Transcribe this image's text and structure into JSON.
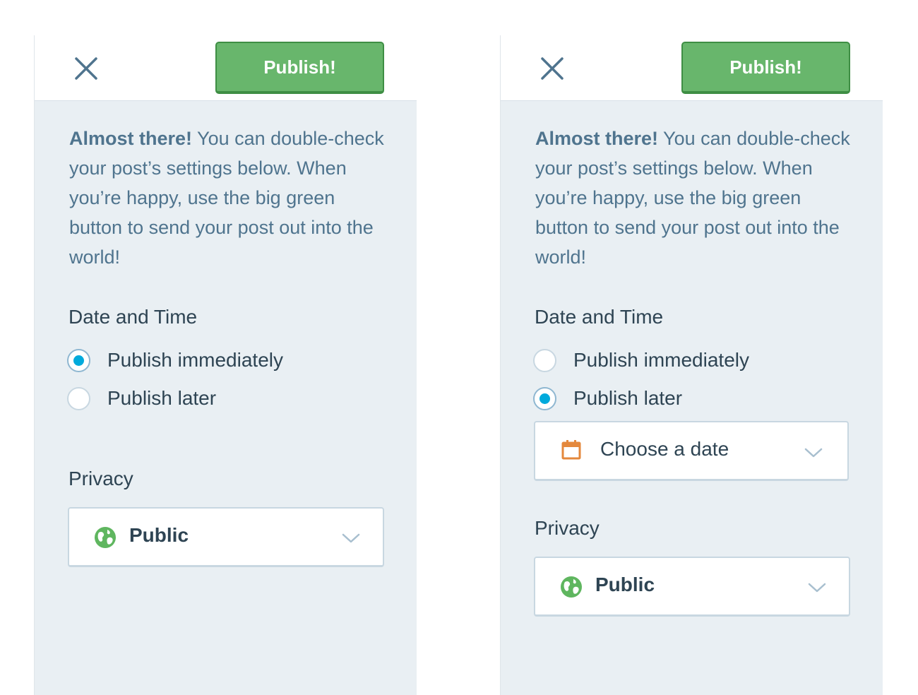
{
  "panels": [
    {
      "publish_label": "Publish!",
      "intro_bold": "Almost there!",
      "intro_rest": " You can double-check your post’s settings below. When you’re happy, use the big green button to send your post out into the world!",
      "date_time_label": "Date and Time",
      "options": [
        {
          "label": "Publish immediately",
          "selected": true
        },
        {
          "label": "Publish later",
          "selected": false
        }
      ],
      "privacy_label": "Privacy",
      "privacy_value": "Public",
      "icons": {
        "close": "close-icon",
        "globe": "globe-icon",
        "chevron": "chevron-down-icon"
      }
    },
    {
      "publish_label": "Publish!",
      "intro_bold": "Almost there!",
      "intro_rest": " You can double-check your post’s settings below. When you’re happy, use the big green button to send your post out into the world!",
      "date_time_label": "Date and Time",
      "options": [
        {
          "label": "Publish immediately",
          "selected": false
        },
        {
          "label": "Publish later",
          "selected": true
        }
      ],
      "date_picker_value": "Choose a date",
      "privacy_label": "Privacy",
      "privacy_value": "Public",
      "icons": {
        "close": "close-icon",
        "calendar": "calendar-icon",
        "globe": "globe-icon",
        "chevron": "chevron-down-icon"
      }
    }
  ],
  "colors": {
    "publish_green": "#68b66c",
    "radio_blue": "#00aadc",
    "calendar_orange": "#e4883c",
    "globe_green": "#5fb65f"
  }
}
